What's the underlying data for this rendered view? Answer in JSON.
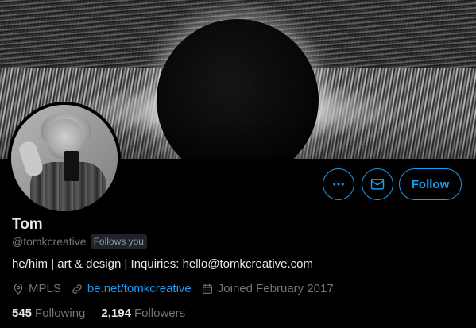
{
  "profile": {
    "name": "Tom",
    "handle": "@tomkcreative",
    "follows_you": "Follows you",
    "bio": "he/him | art & design | Inquiries: hello@tomkcreative.com",
    "location": "MPLS",
    "website": "be.net/tomkcreative",
    "joined": "Joined February 2017"
  },
  "stats": {
    "following_count": "545",
    "following_label": "Following",
    "followers_count": "2,194",
    "followers_label": "Followers"
  },
  "actions": {
    "follow_label": "Follow",
    "more_icon": "more-icon",
    "message_icon": "mail-icon"
  },
  "colors": {
    "accent": "#1d9bf0",
    "background": "#000000",
    "muted": "#6e767d"
  }
}
